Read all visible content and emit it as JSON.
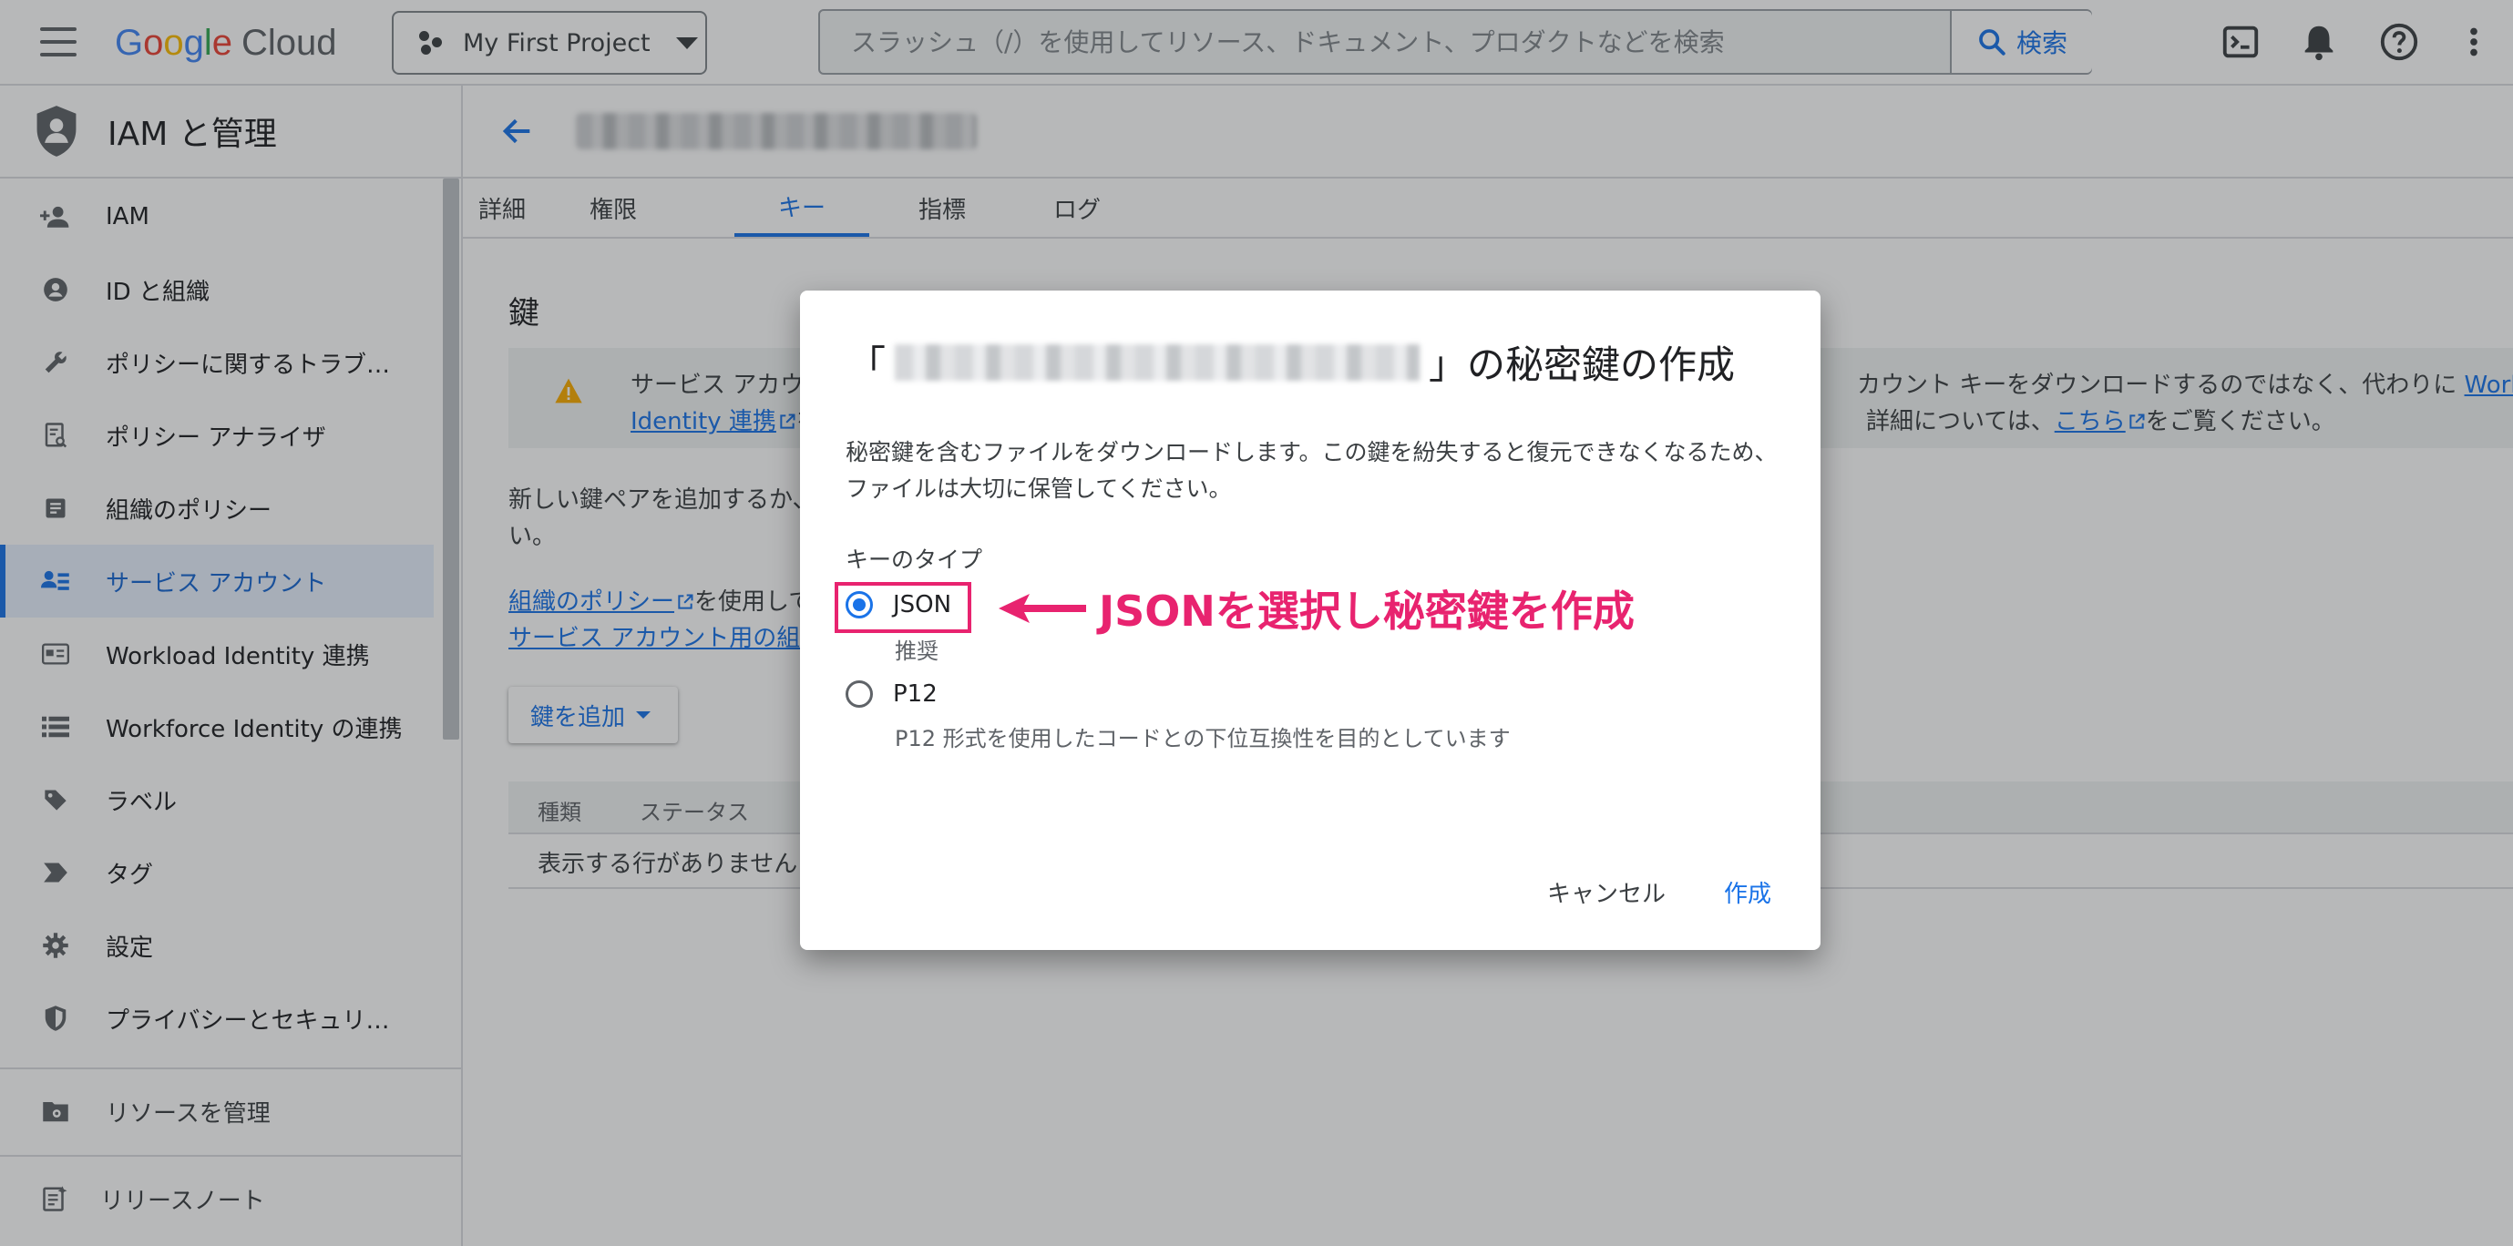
{
  "topbar": {
    "logo_google": "Google",
    "logo_cloud": "Cloud",
    "project_name": "My First Project",
    "search_placeholder": "スラッシュ（/）を使用してリソース、ドキュメント、プロダクトなどを検索",
    "search_button": "検索",
    "icons": [
      "menu-icon",
      "terminal-icon",
      "bell-icon",
      "help-icon",
      "more-vert-icon"
    ]
  },
  "sidebar": {
    "title": "IAM と管理",
    "items": [
      {
        "label": "IAM",
        "icon": "person-add-icon"
      },
      {
        "label": "ID と組織",
        "icon": "account-circle-icon"
      },
      {
        "label": "ポリシーに関するトラブ…",
        "icon": "wrench-icon"
      },
      {
        "label": "ポリシー アナライザ",
        "icon": "analyzer-icon"
      },
      {
        "label": "組織のポリシー",
        "icon": "document-icon"
      },
      {
        "label": "サービス アカウント",
        "icon": "service-account-icon"
      },
      {
        "label": "Workload Identity 連携",
        "icon": "id-card-icon"
      },
      {
        "label": "Workforce Identity の連携",
        "icon": "list-icon"
      },
      {
        "label": "ラベル",
        "icon": "label-tag-icon"
      },
      {
        "label": "タグ",
        "icon": "tag-icon"
      },
      {
        "label": "設定",
        "icon": "gear-icon"
      },
      {
        "label": "プライバシーとセキュリ…",
        "icon": "shield-icon"
      }
    ],
    "manage_resources": "リソースを管理",
    "release_notes": "リリースノート",
    "active_index": 5
  },
  "main": {
    "tabs": [
      "詳細",
      "権限",
      "キー",
      "指標",
      "ログ"
    ],
    "active_tab": "キー",
    "section_title": "鍵",
    "banner": {
      "line1_left": "サービス アカウ",
      "line1_right_prefix": "カウント キーをダウンロードするのではなく、代わりに ",
      "line1_right_link": "Workload",
      "line2_left_link": "Identity 連携",
      "line2_left_suffix": "を",
      "line2_right_prefix": "詳細については、",
      "line2_right_link": "こちら",
      "line2_right_suffix": "をご覧ください。"
    },
    "para1_line1": "新しい鍵ペアを追加するか、",
    "para1_line2": "い。",
    "para2_link1": "組織のポリシー",
    "para2_suffix": "を使用して",
    "para2_link2": "サービス アカウント用の組",
    "add_key_button": "鍵を追加",
    "table": {
      "headers": [
        "種類",
        "ステータス"
      ],
      "empty_message": "表示する行がありません"
    }
  },
  "dialog": {
    "title_prefix": "「",
    "title_suffix": "」の秘密鍵の作成",
    "description": "秘密鍵を含むファイルをダウンロードします。この鍵を紛失すると復元できなくなるため、ファイルは大切に保管してください。",
    "key_type_label": "キーのタイプ",
    "options": [
      {
        "label": "JSON",
        "sublabel": "推奨",
        "checked": true
      },
      {
        "label": "P12",
        "sublabel": "P12 形式を使用したコードとの下位互換性を目的としています",
        "checked": false
      }
    ],
    "cancel_button": "キャンセル",
    "create_button": "作成"
  },
  "annotation": {
    "text": "JSONを選択し秘密鍵を作成",
    "color": "#e8236f"
  },
  "colors": {
    "accent": "#1a73e8",
    "active_bg": "#e8f0fe",
    "warning": "#f9ab00"
  }
}
